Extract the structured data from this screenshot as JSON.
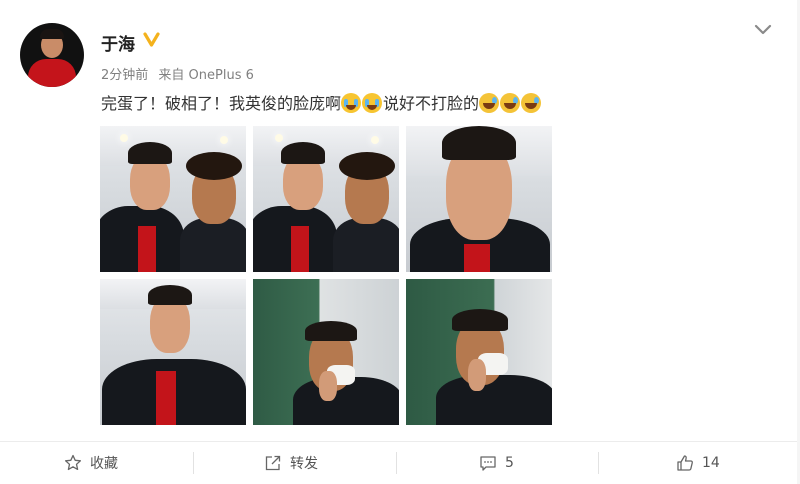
{
  "user": {
    "name": "于海",
    "time": "2分钟前",
    "source": "来自 OnePlus 6",
    "verified_color": "#f4b21d"
  },
  "post": {
    "text_part1": "完蛋了！破相了！我英俊的脸庞啊",
    "text_part2": "说好不打脸的",
    "emojis_after_part1": [
      "crying-face",
      "crying-face"
    ],
    "emojis_after_part2": [
      "laugh-cry-face",
      "laugh-cry-face",
      "laugh-cry-face"
    ]
  },
  "photos": [
    {
      "name": "selfie-with-teammate-1"
    },
    {
      "name": "selfie-with-teammate-2"
    },
    {
      "name": "selfie-solo-closeup"
    },
    {
      "name": "selfie-solo-jacket"
    },
    {
      "name": "selfie-train-tissue-1"
    },
    {
      "name": "selfie-train-tissue-2"
    }
  ],
  "actions": {
    "favorite": {
      "label": "收藏",
      "icon": "star-icon"
    },
    "repost": {
      "label": "转发",
      "icon": "share-icon"
    },
    "comment": {
      "label": "5",
      "icon": "comment-icon"
    },
    "like": {
      "label": "14",
      "icon": "thumbs-up-icon"
    }
  }
}
